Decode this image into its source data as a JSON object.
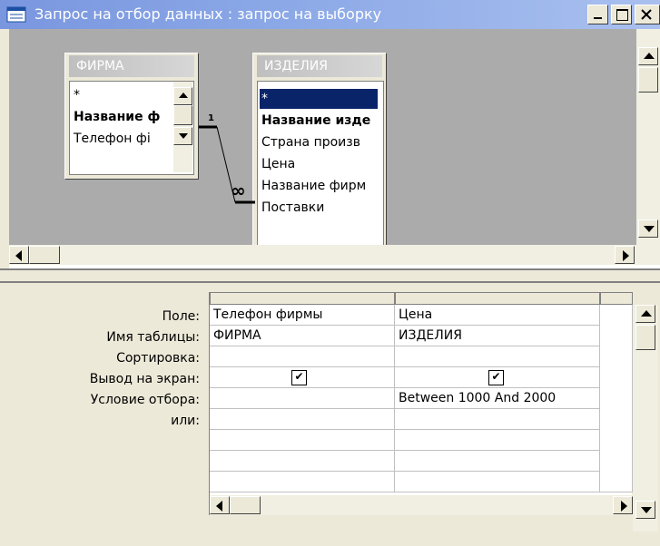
{
  "window": {
    "title": "Запрос на отбор данных : запрос на выборку",
    "buttons": {
      "minimize": "_",
      "maximize": "□",
      "close": "×"
    }
  },
  "tables": [
    {
      "name": "ФИРМА",
      "fields": [
        "*",
        "Название ф",
        "Телефон фі"
      ]
    },
    {
      "name": "ИЗДЕЛИЯ",
      "fields": [
        "*",
        "Название изде",
        "Страна произв",
        "Цена",
        "Название фирм",
        "Поставки"
      ]
    }
  ],
  "relationship": {
    "one_label": "1",
    "many_label": "∞"
  },
  "grid": {
    "row_labels": [
      "Поле:",
      "Имя таблицы:",
      "Сортировка:",
      "Вывод на экран:",
      "Условие отбора:",
      "или:"
    ],
    "columns": [
      {
        "field": "Телефон фирмы",
        "table": "ФИРМА",
        "sort": "",
        "show": true,
        "criteria": "",
        "or": ""
      },
      {
        "field": "Цена",
        "table": "ИЗДЕЛИЯ",
        "sort": "",
        "show": true,
        "criteria": "Between 1000 And 2000",
        "or": ""
      }
    ]
  },
  "icons": {
    "window": "query-window-icon",
    "scroll_up": "arrow-up-icon",
    "scroll_down": "arrow-down-icon",
    "scroll_left": "arrow-left-icon",
    "scroll_right": "arrow-right-icon",
    "check": "checkmark-icon"
  }
}
